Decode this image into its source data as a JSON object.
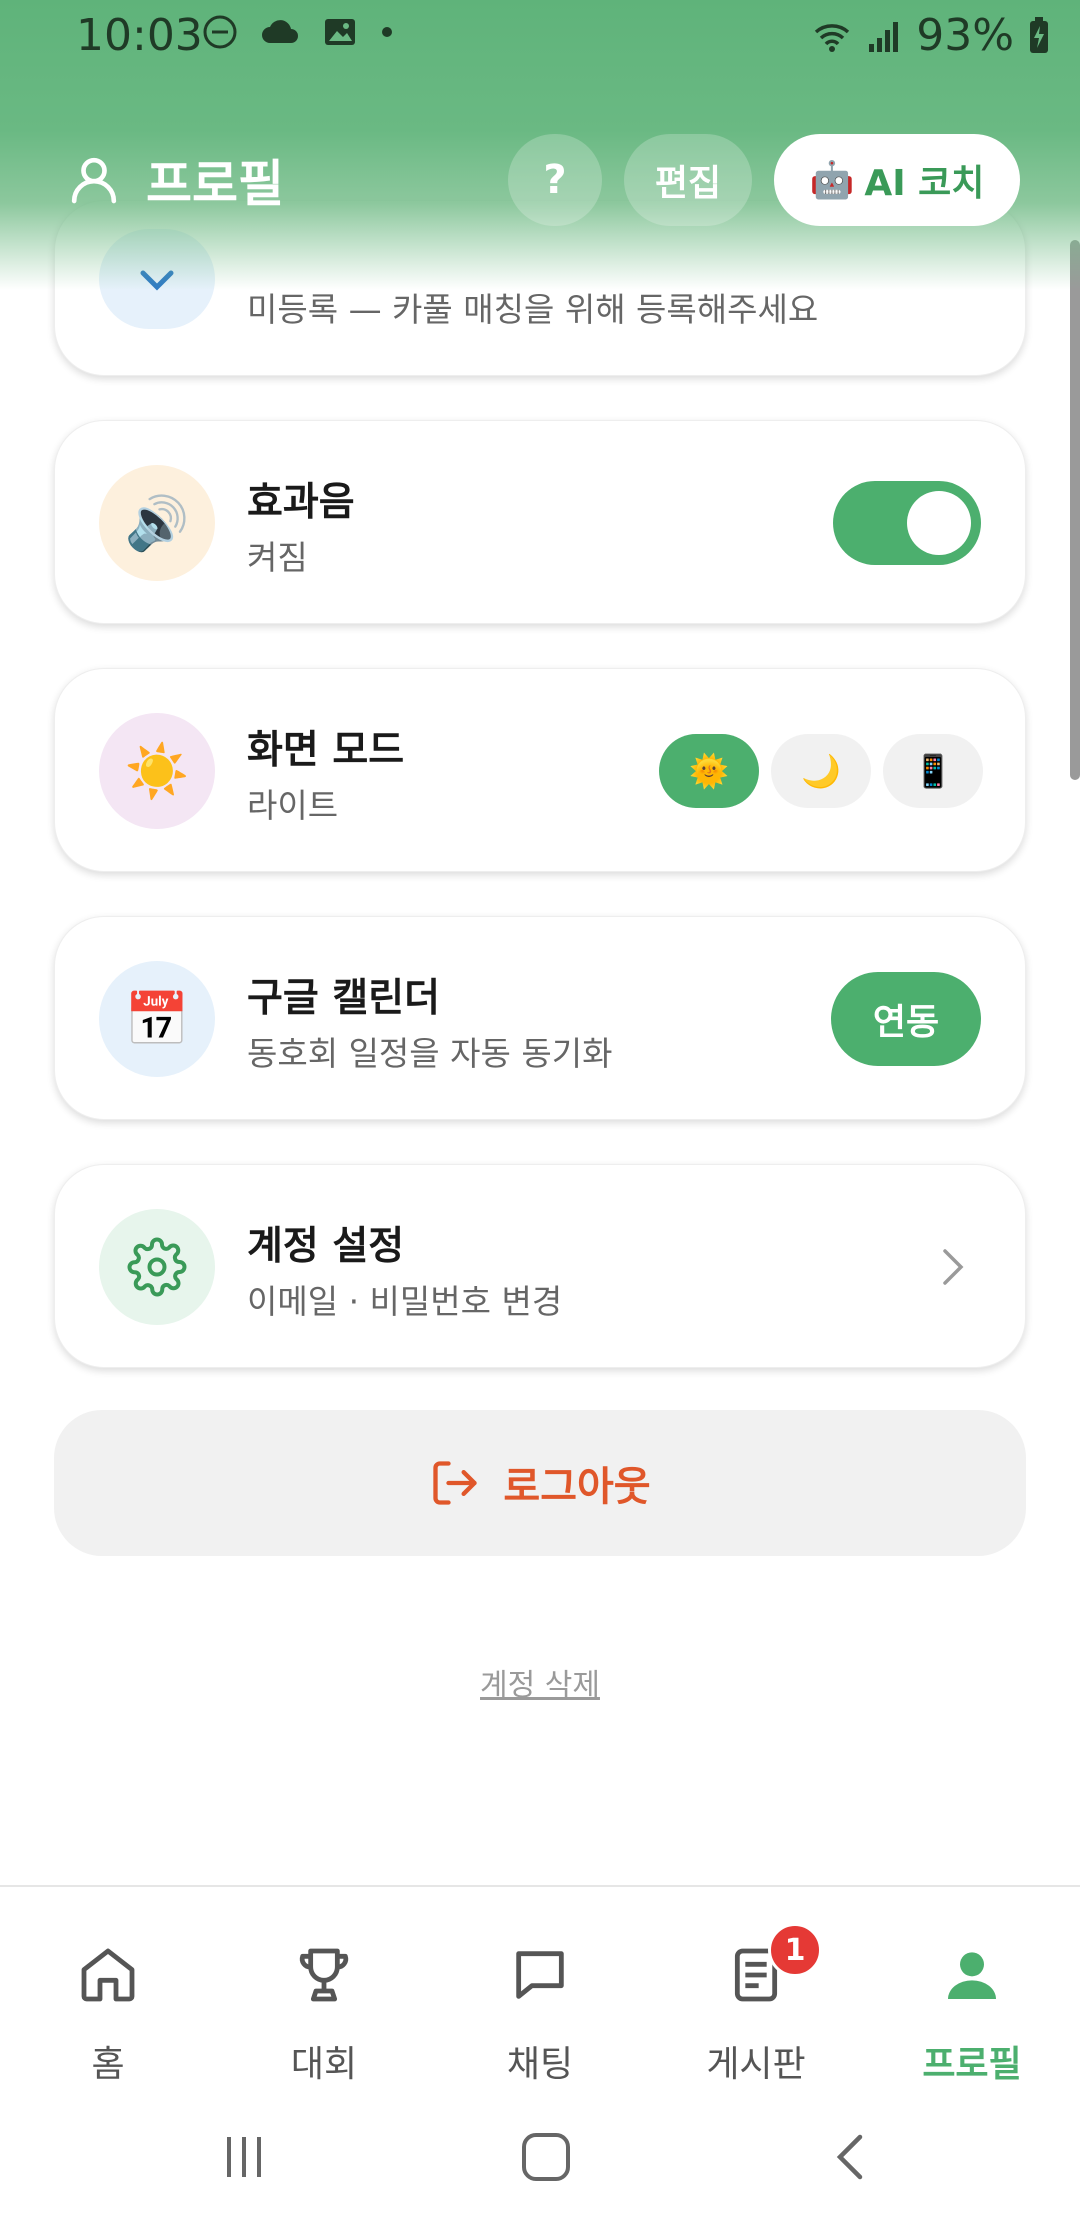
{
  "status_bar": {
    "time": "10:03",
    "battery": "93%"
  },
  "header": {
    "title": "프로필",
    "help_label": "?",
    "edit_label": "편집",
    "coach_label": "AI 코치"
  },
  "partial_card": {
    "subtitle": "미등록 — 카풀 매칭을 위해 등록해주세요"
  },
  "sound_card": {
    "title": "효과음",
    "subtitle": "켜짐",
    "toggle_on": true
  },
  "display_card": {
    "title": "화면 모드",
    "subtitle": "라이트",
    "modes": [
      "light",
      "dark",
      "system"
    ],
    "selected_mode": "light"
  },
  "calendar_card": {
    "title": "구글 캘린더",
    "subtitle": "동호회 일정을 자동 동기화",
    "button_label": "연동"
  },
  "account_card": {
    "title": "계정 설정",
    "subtitle": "이메일 · 비밀번호 변경"
  },
  "logout_label": "로그아웃",
  "delete_account_label": "계정 삭제",
  "bottom_nav": {
    "items": [
      {
        "label": "홈",
        "icon": "home-icon"
      },
      {
        "label": "대회",
        "icon": "trophy-icon"
      },
      {
        "label": "채팅",
        "icon": "chat-icon"
      },
      {
        "label": "게시판",
        "icon": "board-icon",
        "badge": "1"
      },
      {
        "label": "프로필",
        "icon": "person-icon",
        "active": true
      }
    ]
  },
  "colors": {
    "accent": "#4caf6e",
    "header": "#5fb37a",
    "logout": "#e0572a",
    "badge": "#e53935"
  }
}
